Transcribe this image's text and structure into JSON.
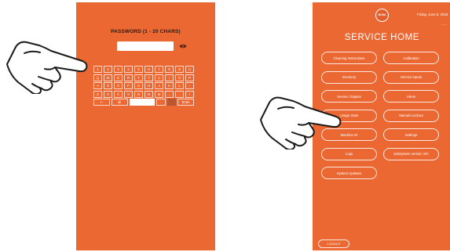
{
  "password_screen": {
    "title": "PASSWORD (1 - 20 CHARS)",
    "password_value": "",
    "eye_icon": "eye-icon",
    "keyboard": {
      "row1": [
        "1",
        "2",
        "3",
        "4",
        "5",
        "6",
        "7",
        "8",
        "9",
        "0"
      ],
      "row2": [
        "Q",
        "W",
        "E",
        "R",
        "T",
        "Y",
        "U",
        "I",
        "O",
        "P"
      ],
      "row3": [
        "A",
        "S",
        "D",
        "F",
        "G",
        "H",
        "J",
        "K",
        "L",
        "-"
      ],
      "row4": [
        "Z",
        "X",
        "C",
        "V",
        "B",
        "N",
        "M",
        ",",
        ".",
        "/"
      ],
      "row5": {
        "back": "<-",
        "at": "@",
        "space": "",
        "dot": ".",
        "hidden": "",
        "enter": "Enter"
      }
    }
  },
  "service_screen": {
    "logo_text": "MONA",
    "date": "Friday, June 8, 2018",
    "more_icon": "···",
    "title": "SERVICE HOME",
    "buttons": [
      "Cleaning Instructions",
      "Calibration",
      "Inventory",
      "Service Inputs",
      "Service Outputs",
      "Alerts",
      "Usage Stats",
      "Manual Lockout",
      "Machine ID",
      "Settings",
      "Logs",
      "Subsystem version info",
      "System Updates"
    ],
    "logout_label": "LOGOUT"
  },
  "pointer_icons": [
    "pointing-hand-icon",
    "pointing-hand-icon"
  ],
  "colors": {
    "accent": "#EC6833",
    "text_on_accent": "#FFFFFF",
    "title_dark": "#2B1A12"
  }
}
